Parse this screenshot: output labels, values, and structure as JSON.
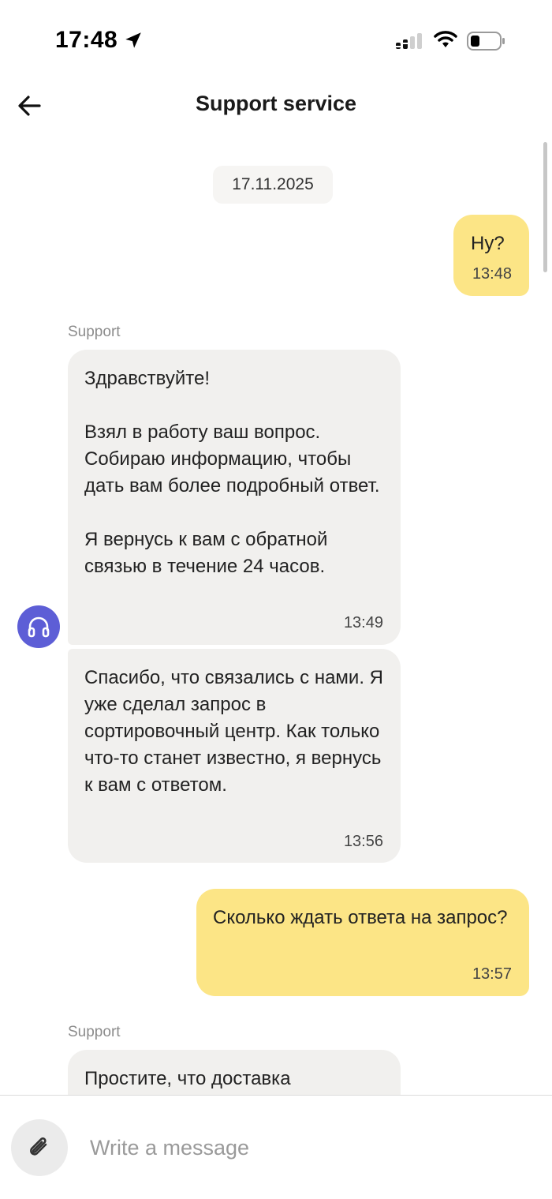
{
  "status_bar": {
    "time": "17:48",
    "icons": [
      "location-arrow-icon",
      "cellular-signal-icon",
      "wifi-icon",
      "battery-icon"
    ]
  },
  "header": {
    "title": "Support service",
    "back_icon": "arrow-left-icon"
  },
  "chat": {
    "date": "17.11.2025",
    "messages": [
      {
        "direction": "outgoing",
        "text": "Ну?",
        "time": "13:48"
      },
      {
        "direction": "incoming",
        "sender": "Support",
        "text": "Здравствуйте!\n\nВзял в работу ваш вопрос. Собираю информацию, чтобы дать вам более подробный ответ.\n\nЯ вернусь к вам с обратной связью в течение 24 часов.",
        "time": "13:49"
      },
      {
        "direction": "incoming",
        "text": "Спасибо, что связались с нами. Я уже сделал запрос в сортировочный центр. Как только что-то станет известно, я вернусь к вам с ответом.",
        "time": "13:56"
      },
      {
        "direction": "outgoing",
        "text": "Сколько ждать ответа на запрос?",
        "time": "13:57"
      },
      {
        "direction": "incoming",
        "sender": "Support",
        "text": "Простите, что доставка"
      }
    ],
    "avatar_icon": "headphones-icon"
  },
  "composer": {
    "placeholder": "Write a message",
    "attach_icon": "paperclip-icon"
  },
  "colors": {
    "outgoing_bubble": "#fce586",
    "incoming_bubble": "#f1f0ee",
    "avatar": "#5d5ed6"
  }
}
